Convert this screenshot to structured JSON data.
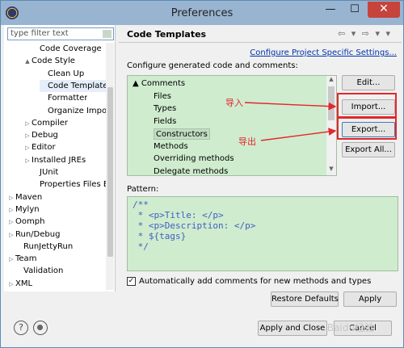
{
  "window": {
    "title": "Preferences",
    "close_label": "✕",
    "minimize_label": "—",
    "maximize_label": "☐"
  },
  "sidebar": {
    "filter_placeholder": "type filter text",
    "items": [
      {
        "label": "Code Coverage",
        "indent": 3,
        "arrow": ""
      },
      {
        "label": "Code Style",
        "indent": 2,
        "arrow": "▲"
      },
      {
        "label": "Clean Up",
        "indent": 4,
        "arrow": ""
      },
      {
        "label": "Code Template",
        "indent": 4,
        "arrow": "",
        "selected": true
      },
      {
        "label": "Formatter",
        "indent": 4,
        "arrow": ""
      },
      {
        "label": "Organize Impo",
        "indent": 4,
        "arrow": ""
      },
      {
        "label": "Compiler",
        "indent": 2,
        "arrow": "▷"
      },
      {
        "label": "Debug",
        "indent": 2,
        "arrow": "▷"
      },
      {
        "label": "Editor",
        "indent": 2,
        "arrow": "▷"
      },
      {
        "label": "Installed JREs",
        "indent": 2,
        "arrow": "▷"
      },
      {
        "label": "JUnit",
        "indent": 3,
        "arrow": ""
      },
      {
        "label": "Properties Files Ed",
        "indent": 3,
        "arrow": ""
      },
      {
        "label": "Maven",
        "indent": 0,
        "arrow": "▷"
      },
      {
        "label": "Mylyn",
        "indent": 0,
        "arrow": "▷"
      },
      {
        "label": "Oomph",
        "indent": 0,
        "arrow": "▷"
      },
      {
        "label": "Run/Debug",
        "indent": 0,
        "arrow": "▷"
      },
      {
        "label": "RunJettyRun",
        "indent": 1,
        "arrow": ""
      },
      {
        "label": "Team",
        "indent": 0,
        "arrow": "▷"
      },
      {
        "label": "Validation",
        "indent": 1,
        "arrow": ""
      },
      {
        "label": "XML",
        "indent": 0,
        "arrow": "▷"
      }
    ]
  },
  "main": {
    "title": "Code Templates",
    "nav_arrows": "⇦ ▾ ⇨ ▾ ▾",
    "config_link": "Configure Project Specific Settings...",
    "generated_label": "Configure generated code and comments:",
    "templates": [
      {
        "label": "Comments",
        "level": 0,
        "arrow": "▲"
      },
      {
        "label": "Files",
        "level": 1
      },
      {
        "label": "Types",
        "level": 1
      },
      {
        "label": "Fields",
        "level": 1
      },
      {
        "label": "Constructors",
        "level": 1,
        "selected": true
      },
      {
        "label": "Methods",
        "level": 1
      },
      {
        "label": "Overriding methods",
        "level": 1
      },
      {
        "label": "Delegate methods",
        "level": 1
      }
    ],
    "buttons": {
      "edit": "Edit...",
      "import": "Import...",
      "export": "Export...",
      "export_all": "Export All...",
      "restore": "Restore Defaults",
      "apply": "Apply"
    },
    "annotations": {
      "import_cn": "导入",
      "export_cn": "导出"
    },
    "pattern_label": "Pattern:",
    "pattern_lines": [
      "/**",
      " * <p>Title: </p>",
      " * <p>Description: </p>",
      " * ${tags}",
      " */"
    ],
    "auto_comments_label": "Automatically add comments for new methods and types",
    "auto_comments_checked": true
  },
  "footer": {
    "apply_close": "Apply and Close",
    "cancel": "Cancel",
    "watermark": "Baidu经验"
  }
}
